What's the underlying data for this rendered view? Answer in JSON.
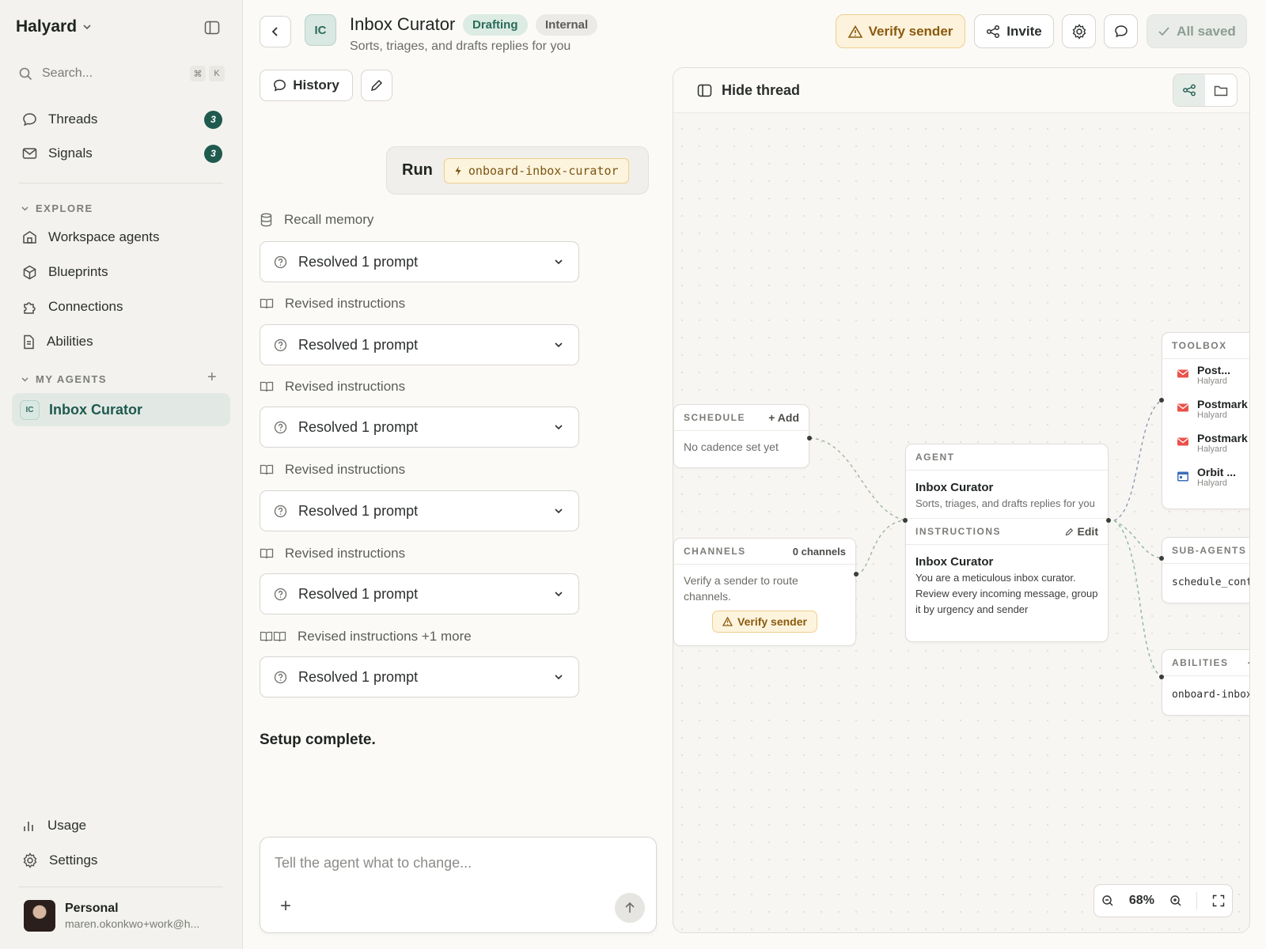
{
  "sidebar": {
    "workspace": "Halyard",
    "search_placeholder": "Search...",
    "shortcut": [
      "⌘",
      "K"
    ],
    "nav": [
      {
        "label": "Threads",
        "count": "3"
      },
      {
        "label": "Signals",
        "count": "3"
      }
    ],
    "explore_label": "EXPLORE",
    "explore": [
      {
        "label": "Workspace agents"
      },
      {
        "label": "Blueprints"
      },
      {
        "label": "Connections"
      },
      {
        "label": "Abilities"
      }
    ],
    "my_agents_label": "MY AGENTS",
    "active_agent": {
      "initials": "IC",
      "label": "Inbox Curator"
    },
    "bottom": [
      {
        "label": "Usage"
      },
      {
        "label": "Settings"
      }
    ],
    "user": {
      "name": "Personal",
      "email": "maren.okonkwo+work@h..."
    }
  },
  "header": {
    "initials": "IC",
    "title": "Inbox Curator",
    "status": "Drafting",
    "visibility": "Internal",
    "subtitle": "Sorts, triages, and drafts replies for you",
    "verify_label": "Verify sender",
    "invite_label": "Invite",
    "saved_label": "All saved"
  },
  "thread": {
    "history_label": "History",
    "run_label": "Run",
    "run_command": "onboard-inbox-curator",
    "steps": [
      {
        "label": "Recall memory"
      },
      {
        "label": "Resolved 1 prompt"
      },
      {
        "label": "Revised instructions"
      },
      {
        "label": "Resolved 1 prompt"
      },
      {
        "label": "Revised instructions"
      },
      {
        "label": "Resolved 1 prompt"
      },
      {
        "label": "Revised instructions"
      },
      {
        "label": "Resolved 1 prompt"
      },
      {
        "label": "Revised instructions"
      },
      {
        "label": "Resolved 1 prompt"
      },
      {
        "label": "Revised instructions +1 more"
      },
      {
        "label": "Resolved 1 prompt"
      }
    ],
    "done_label": "Setup complete.",
    "composer_placeholder": "Tell the agent what to change..."
  },
  "canvas": {
    "hide_thread_label": "Hide thread",
    "schedule": {
      "title": "SCHEDULE",
      "action": "+ Add",
      "body": "No cadence set yet"
    },
    "channels": {
      "title": "CHANNELS",
      "count": "0 channels",
      "body": "Verify a sender to route channels.",
      "verify_label": "Verify sender"
    },
    "agent": {
      "title": "AGENT",
      "name": "Inbox Curator",
      "description": "Sorts, triages, and drafts replies for you",
      "instructions_title": "INSTRUCTIONS",
      "edit_label": "Edit",
      "instructions_name": "Inbox Curator",
      "instructions_text": "You are a meticulous inbox curator. Review every incoming message, group it by urgency and sender"
    },
    "toolbox": {
      "title": "TOOLBOX",
      "items": [
        {
          "name": "Post...",
          "org": "Halyard",
          "icon": "mail-icon"
        },
        {
          "name": "Postmark I",
          "org": "Halyard",
          "icon": "mail-icon"
        },
        {
          "name": "Postmark (",
          "org": "Halyard",
          "icon": "mail-icon"
        },
        {
          "name": "Orbit ...",
          "org": "Halyard",
          "icon": "calendar-icon"
        }
      ]
    },
    "subagents": {
      "title": "SUB-AGENTS",
      "item": "schedule_cont"
    },
    "abilities": {
      "title": "ABILITIES",
      "action": "+",
      "item": "onboard-inbox"
    },
    "zoom": "68%"
  },
  "colors": {
    "accent": "#1f5a4e",
    "warn_bg": "#fdf4de",
    "warn_text": "#8a5a0d"
  }
}
